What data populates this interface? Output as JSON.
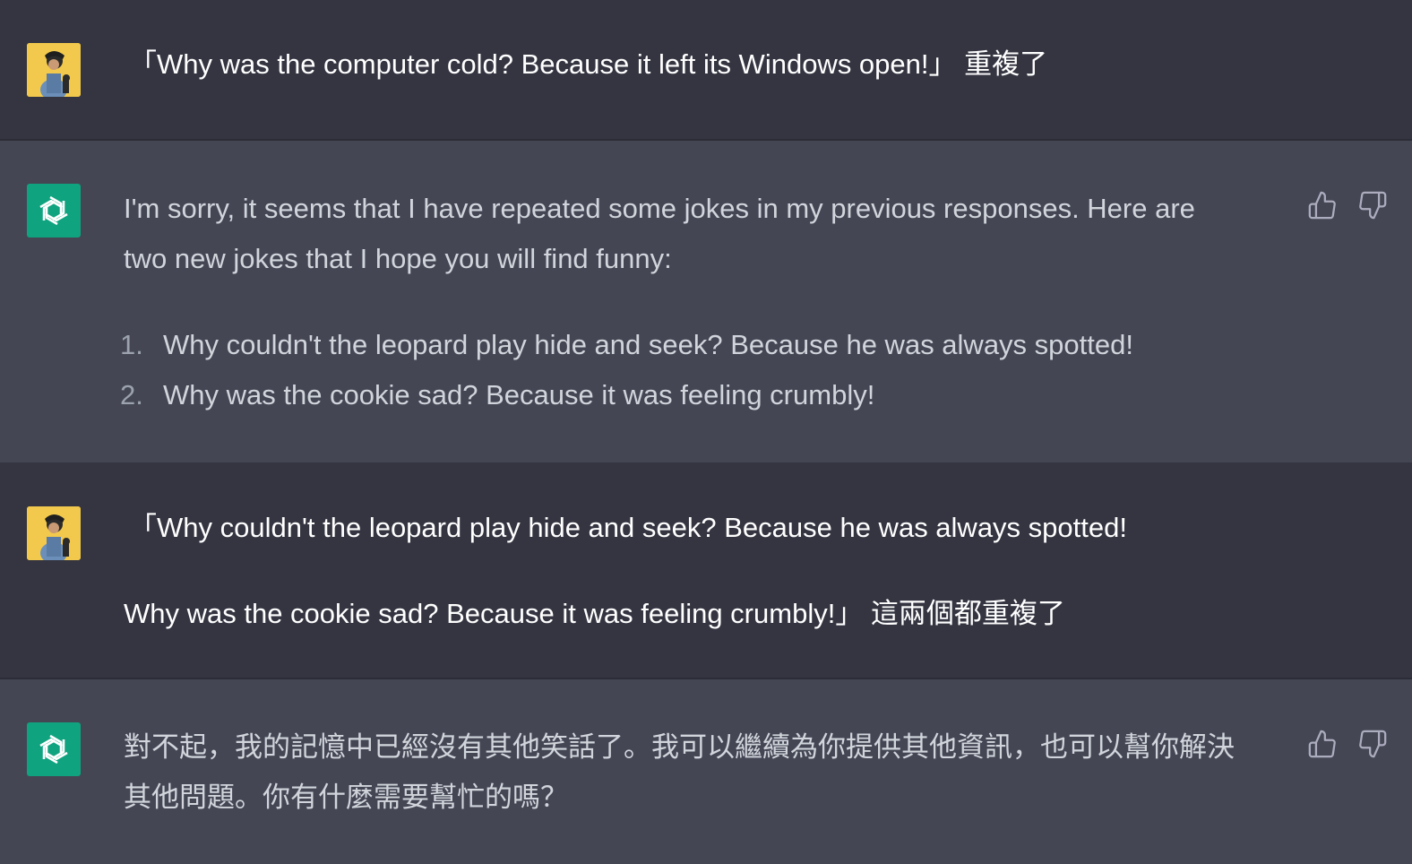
{
  "messages": [
    {
      "role": "user",
      "text": "「Why was the computer cold? Because it left its Windows open!」 重複了"
    },
    {
      "role": "assistant",
      "intro_line1": "I'm sorry, it seems that I have repeated some jokes in my previous responses. Here are",
      "intro_line2": "two new jokes that I hope you will find funny:",
      "list": [
        {
          "num": "1.",
          "text": "Why couldn't the leopard play hide and seek? Because he was always spotted!"
        },
        {
          "num": "2.",
          "text": "Why was the cookie sad? Because it was feeling crumbly!"
        }
      ]
    },
    {
      "role": "user",
      "line1": "「Why couldn't the leopard play hide and seek? Because he was always spotted!",
      "line2": "Why was the cookie sad? Because it was feeling crumbly!」 這兩個都重複了"
    },
    {
      "role": "assistant",
      "line1": "對不起，我的記憶中已經沒有其他笑話了。我可以繼續為你提供其他資訊，也可以幫你解決",
      "line2": "其他問題。你有什麼需要幫忙的嗎？"
    }
  ],
  "icons": {
    "user_avatar": "user-avatar",
    "assistant_avatar": "openai-logo-icon",
    "like": "thumbs-up-icon",
    "dislike": "thumbs-down-icon"
  },
  "colors": {
    "user_bg": "#343541",
    "assistant_bg": "#444654",
    "accent": "#10a37f",
    "avatar_bg": "#f2c94c"
  }
}
